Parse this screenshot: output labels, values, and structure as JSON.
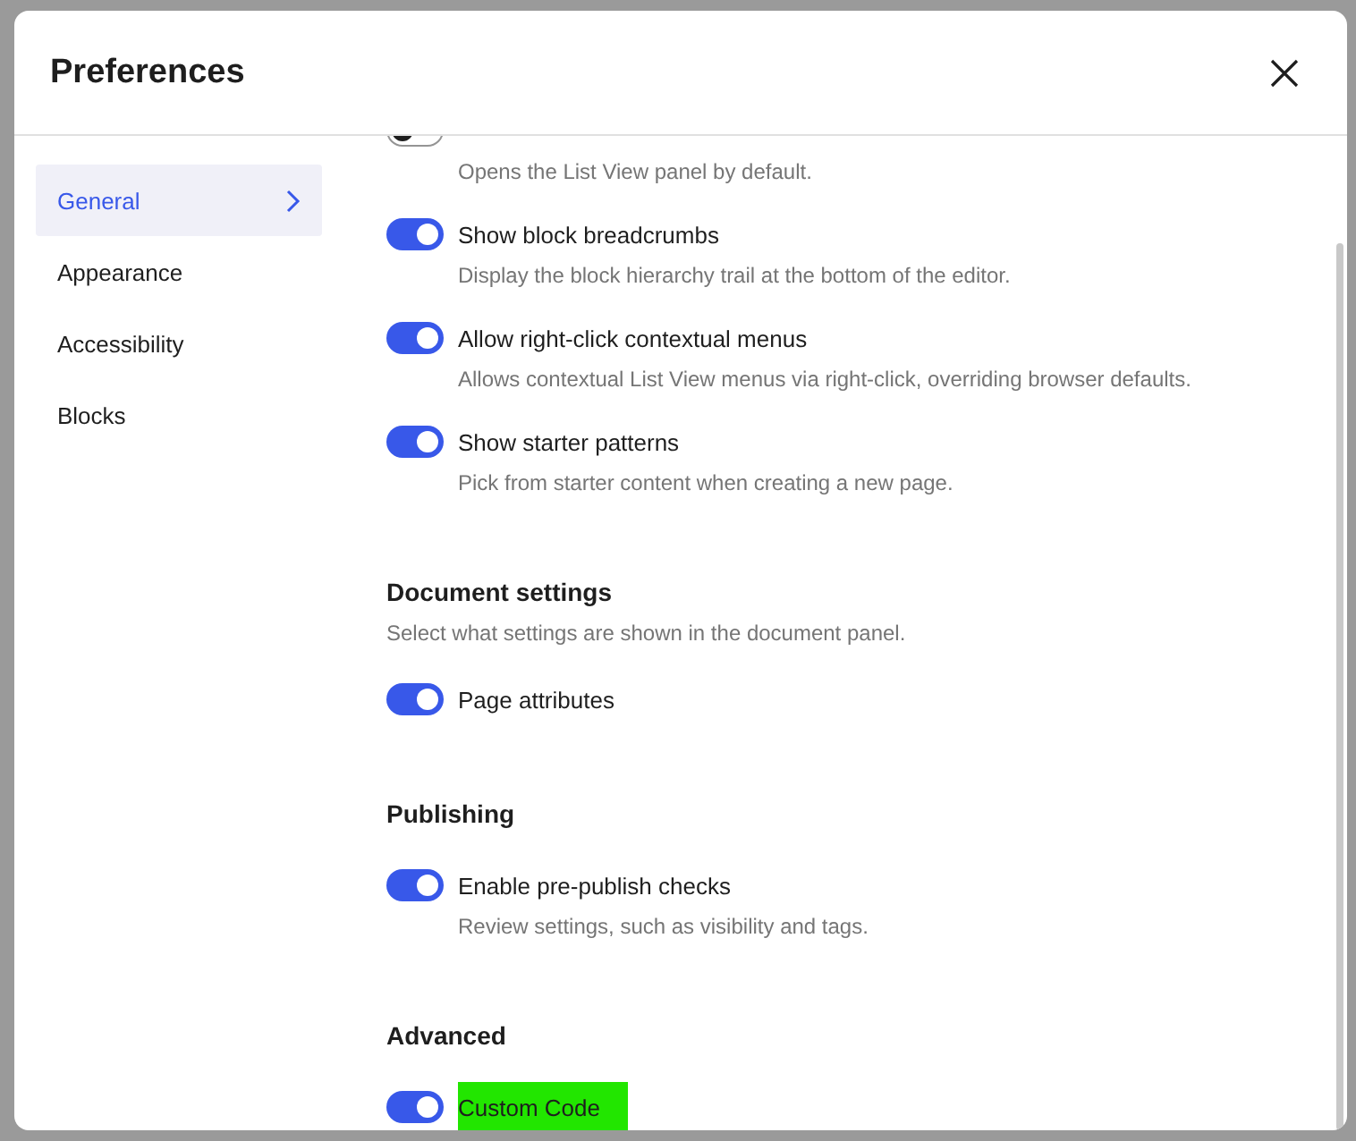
{
  "dialog": {
    "title": "Preferences"
  },
  "sidebar": {
    "items": [
      {
        "label": "General",
        "selected": true
      },
      {
        "label": "Appearance",
        "selected": false
      },
      {
        "label": "Accessibility",
        "selected": false
      },
      {
        "label": "Blocks",
        "selected": false
      }
    ]
  },
  "sections": [
    {
      "options": [
        {
          "description": "Opens the List View panel by default.",
          "on": false
        },
        {
          "label": "Show block breadcrumbs",
          "description": "Display the block hierarchy trail at the bottom of the editor.",
          "on": true
        },
        {
          "label": "Allow right-click contextual menus",
          "description": "Allows contextual List View menus via right-click, overriding browser defaults.",
          "on": true
        },
        {
          "label": "Show starter patterns",
          "description": "Pick from starter content when creating a new page.",
          "on": true
        }
      ]
    },
    {
      "heading": "Document settings",
      "description": "Select what settings are shown in the document panel.",
      "options": [
        {
          "label": "Page attributes",
          "on": true
        }
      ]
    },
    {
      "heading": "Publishing",
      "options": [
        {
          "label": "Enable pre-publish checks",
          "description": "Review settings, such as visibility and tags.",
          "on": true
        }
      ]
    },
    {
      "heading": "Advanced",
      "options": [
        {
          "label": "Custom Code",
          "on": true,
          "highlighted": true
        }
      ]
    }
  ]
}
